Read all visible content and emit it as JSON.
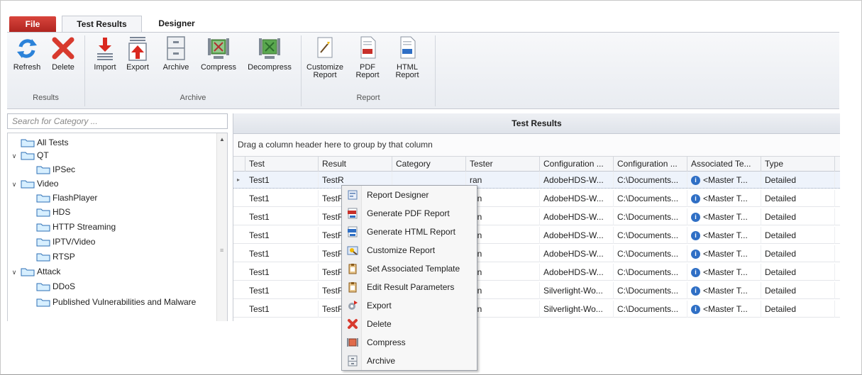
{
  "tabs": {
    "file": "File",
    "test_results": "Test Results",
    "designer": "Designer"
  },
  "ribbon": {
    "buttons": {
      "refresh": "Refresh",
      "delete": "Delete",
      "import": "Import",
      "export": "Export",
      "archive": "Archive",
      "compress": "Compress",
      "decompress": "Decompress",
      "customize": "Customize\nReport",
      "pdf": "PDF\nReport",
      "html": "HTML\nReport"
    },
    "groups": {
      "results": "Results",
      "archive": "Archive",
      "report": "Report"
    }
  },
  "left_panel": {
    "search_placeholder": "Search for Category ...",
    "tree": {
      "all_tests": "All Tests",
      "qt": "QT",
      "ipsec": "IPSec",
      "video": "Video",
      "flashplayer": "FlashPlayer",
      "hds": "HDS",
      "http_streaming": "HTTP Streaming",
      "iptv": "IPTV/Video",
      "rtsp": "RTSP",
      "attack": "Attack",
      "ddos": "DDoS",
      "published": "Published Vulnerabilities and Malware"
    }
  },
  "grid": {
    "title": "Test Results",
    "group_hint": "Drag a column header here to group by that column",
    "columns": [
      "Test",
      "Result",
      "Category",
      "Tester",
      "Configuration ...",
      "Configuration ...",
      "Associated Te...",
      "Type"
    ],
    "rows": [
      [
        "Test1",
        "TestR",
        "",
        "ran",
        "AdobeHDS-W...",
        "C:\\Documents...",
        "<Master T...",
        "Detailed"
      ],
      [
        "Test1",
        "TestR",
        "",
        "ran",
        "AdobeHDS-W...",
        "C:\\Documents...",
        "<Master T...",
        "Detailed"
      ],
      [
        "Test1",
        "TestR",
        "",
        "ran",
        "AdobeHDS-W...",
        "C:\\Documents...",
        "<Master T...",
        "Detailed"
      ],
      [
        "Test1",
        "TestR",
        "",
        "ran",
        "AdobeHDS-W...",
        "C:\\Documents...",
        "<Master T...",
        "Detailed"
      ],
      [
        "Test1",
        "TestR",
        "",
        "ran",
        "AdobeHDS-W...",
        "C:\\Documents...",
        "<Master T...",
        "Detailed"
      ],
      [
        "Test1",
        "TestR",
        "",
        "ran",
        "AdobeHDS-W...",
        "C:\\Documents...",
        "<Master T...",
        "Detailed"
      ],
      [
        "Test1",
        "TestR",
        "",
        "ran",
        "Silverlight-Wo...",
        "C:\\Documents...",
        "<Master T...",
        "Detailed"
      ],
      [
        "Test1",
        "TestR",
        "",
        "ran",
        "Silverlight-Wo...",
        "C:\\Documents...",
        "<Master T...",
        "Detailed"
      ]
    ]
  },
  "context_menu": {
    "items": [
      {
        "label": "Report Designer",
        "icon": "report-designer-icon"
      },
      {
        "label": "Generate PDF Report",
        "icon": "pdf-icon"
      },
      {
        "label": "Generate HTML Report",
        "icon": "html-icon"
      },
      {
        "label": "Customize Report",
        "icon": "customize-icon"
      },
      {
        "label": "Set Associated Template",
        "icon": "template-icon"
      },
      {
        "label": "Edit Result Parameters",
        "icon": "edit-params-icon"
      },
      {
        "label": "Export",
        "icon": "export-icon"
      },
      {
        "label": "Delete",
        "icon": "delete-icon"
      },
      {
        "label": "Compress",
        "icon": "compress-icon"
      },
      {
        "label": "Archive",
        "icon": "archive-icon"
      }
    ]
  },
  "colors": {
    "file_tab": "#c0322b",
    "accent_blue": "#2f6fc5",
    "delete_red": "#d83a2e"
  }
}
